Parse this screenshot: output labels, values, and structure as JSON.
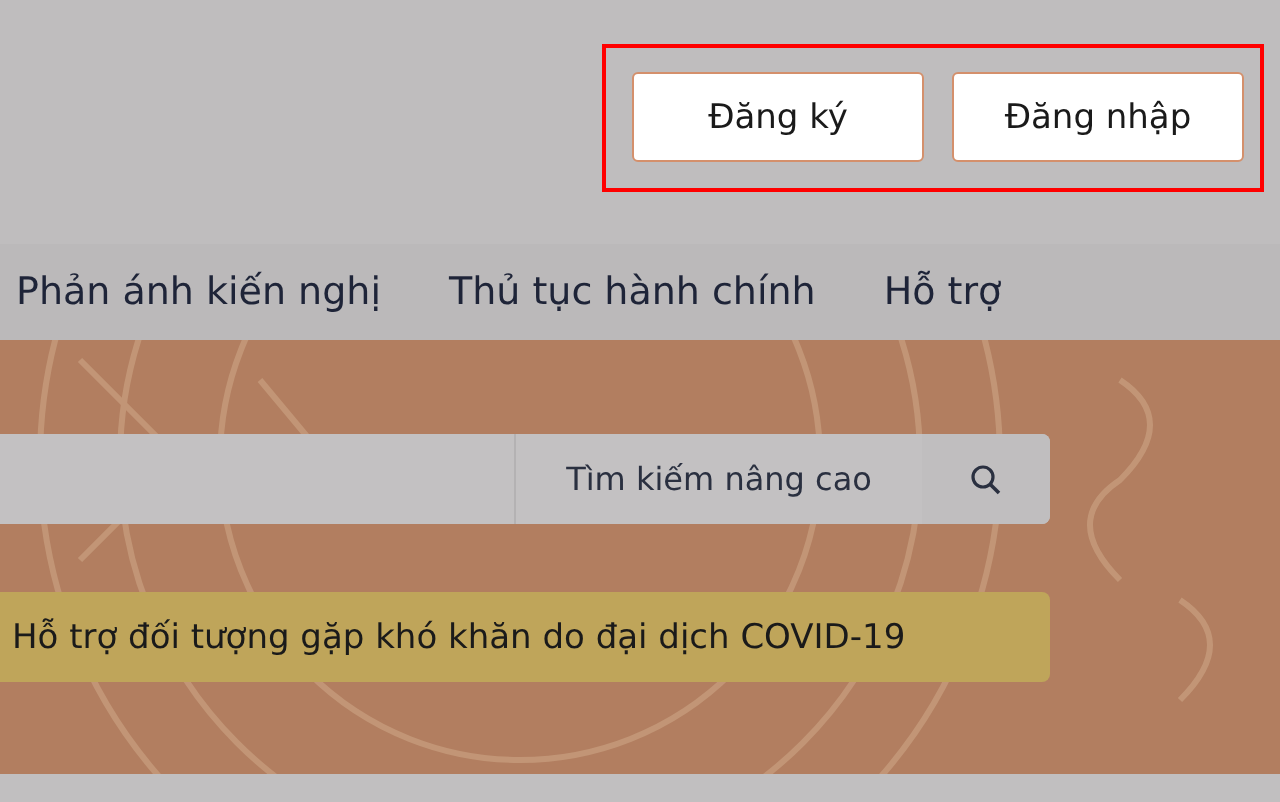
{
  "header": {
    "buttons": [
      {
        "label": "Đăng ký"
      },
      {
        "label": "Đăng nhập"
      }
    ],
    "highlighted": true
  },
  "nav": {
    "items": [
      {
        "label": "Phản ánh kiến nghị"
      },
      {
        "label": "Thủ tục hành chính"
      },
      {
        "label": "Hỗ trợ"
      }
    ]
  },
  "search": {
    "advanced_label": "Tìm kiếm nâng cao"
  },
  "notice": {
    "text": "Hỗ trợ đối tượng gặp khó khăn do đại dịch COVID-19"
  }
}
